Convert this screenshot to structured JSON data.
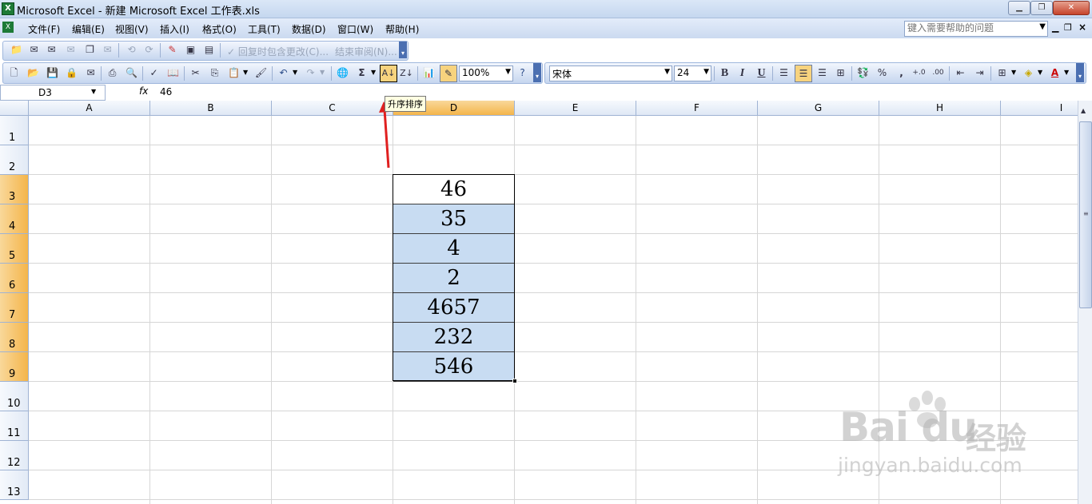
{
  "window": {
    "title": "Microsoft Excel - 新建 Microsoft Excel 工作表.xls",
    "app_icon": "excel-icon"
  },
  "menu": {
    "items": [
      "文件(F)",
      "编辑(E)",
      "视图(V)",
      "插入(I)",
      "格式(O)",
      "工具(T)",
      "数据(D)",
      "窗口(W)",
      "帮助(H)"
    ],
    "help_placeholder": "键入需要帮助的问题"
  },
  "review_toolbar": {
    "reply_changes": "回复时包含更改(C)...",
    "end_review": "结束审阅(N)..."
  },
  "standard_toolbar": {
    "zoom": "100%",
    "font": "宋体",
    "font_size": "24",
    "bold": "B",
    "italic": "I",
    "underline": "U",
    "percent": "%",
    "comma": ","
  },
  "formula_bar": {
    "name_box": "D3",
    "fx": "fx",
    "formula": "46"
  },
  "tooltip": "升序排序",
  "sheet": {
    "columns": [
      "A",
      "B",
      "C",
      "D",
      "E",
      "F",
      "G",
      "H",
      "I"
    ],
    "selected_column": "D",
    "rows": [
      "1",
      "2",
      "3",
      "4",
      "5",
      "6",
      "7",
      "8",
      "9",
      "10",
      "11",
      "12",
      "13"
    ],
    "selected_rows": [
      "3",
      "4",
      "5",
      "6",
      "7",
      "8",
      "9"
    ],
    "d_values": [
      "46",
      "35",
      "4",
      "2",
      "4657",
      "232",
      "546"
    ],
    "active_cell": "D3"
  },
  "watermark": {
    "logo": "Bai du",
    "cn": "经验",
    "url": "jingyan.baidu.com"
  },
  "colors": {
    "selection": "#c8dcf2",
    "header_selected": "#f4b54b",
    "arrow": "#e02020"
  }
}
